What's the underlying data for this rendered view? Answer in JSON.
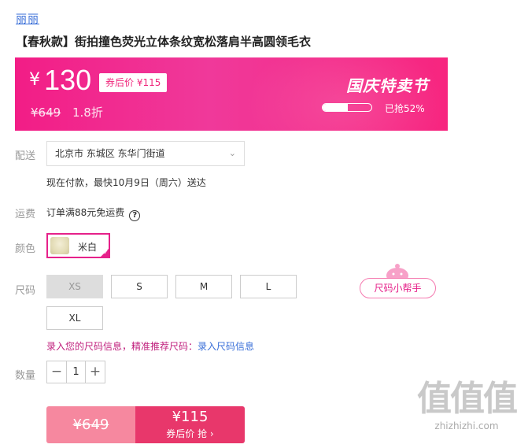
{
  "brand": "丽丽",
  "title": "【春秋款】街拍撞色荧光立体条纹宽松落肩半高圆领毛衣",
  "banner": {
    "currency": "¥",
    "price": "130",
    "coupon_badge": "券后价 ¥115",
    "original_price": "¥649",
    "discount": "1.8折",
    "festival": "国庆特卖节",
    "sold_progress_percent": 52,
    "sold_text": "已抢52%"
  },
  "delivery": {
    "label": "配送",
    "address": "北京市 东城区 东华门街道",
    "note": "现在付款，最快10月9日（周六）送达"
  },
  "shipping": {
    "label": "运费",
    "text": "订单满88元免运费",
    "help_glyph": "?"
  },
  "color": {
    "label": "颜色",
    "selected": "米白"
  },
  "size": {
    "label": "尺码",
    "options": [
      "XS",
      "S",
      "M",
      "L",
      "XL"
    ],
    "helper": "尺码小帮手",
    "tip_prefix": "录入您的尺码信息，精准推荐尺码：",
    "tip_link": "录入尺码信息"
  },
  "quantity": {
    "label": "数量",
    "minus": "−",
    "value": "1",
    "plus": "+"
  },
  "buy": {
    "original": "¥649",
    "price": "¥115",
    "action": "券后价 抢 ›"
  },
  "watermark": {
    "big": "值值值",
    "site": "zhizhizhi.com"
  },
  "colors": {
    "accent": "#e6218a",
    "banner": "#f21d86",
    "buy_left": "#f6889f",
    "buy_right": "#e8376b",
    "link": "#3a6fd8"
  }
}
